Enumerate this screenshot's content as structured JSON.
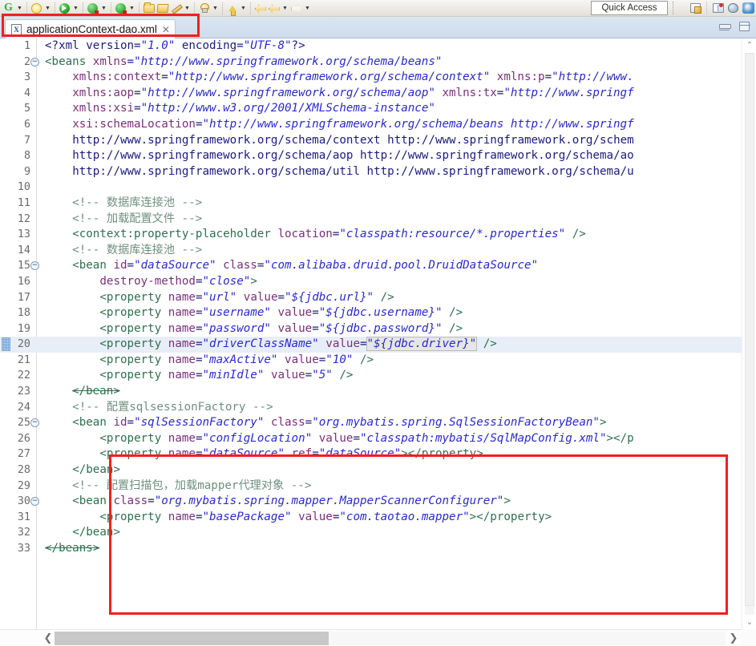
{
  "window": {
    "app": "Eclipse IDE",
    "quick_access_label": "Quick Access"
  },
  "toolbar": {
    "icons": [
      {
        "name": "google-search-icon",
        "label": "G"
      },
      {
        "name": "debug-icon",
        "label": "Debug"
      },
      {
        "name": "run-icon",
        "label": "Run"
      },
      {
        "name": "run-external-tools-icon",
        "label": "External Tools"
      },
      {
        "name": "run-configurations-icon",
        "label": "Run Configurations"
      },
      {
        "name": "new-folder-icon",
        "label": "New"
      },
      {
        "name": "open-folder-icon",
        "label": "Open"
      },
      {
        "name": "build-icon",
        "label": "Build"
      },
      {
        "name": "tip-icon",
        "label": "Hint"
      },
      {
        "name": "up-arrow-icon",
        "label": "Up"
      },
      {
        "name": "back-arrow-icon",
        "label": "Back"
      },
      {
        "name": "forward-arrow-icon",
        "label": "Forward"
      }
    ],
    "right_icons": [
      {
        "name": "open-perspective-icon",
        "label": "Open Perspective"
      },
      {
        "name": "java-perspective-icon",
        "label": "Java EE"
      },
      {
        "name": "debug-perspective-icon",
        "label": "Debug"
      },
      {
        "name": "web-perspective-icon",
        "label": "Web"
      }
    ]
  },
  "editor_tab": {
    "file_icon_letter": "X",
    "filename": "applicationContext-dao.xml",
    "close_glyph": "✕"
  },
  "view_controls": {
    "minimize_title": "Minimize",
    "maximize_title": "Maximize"
  },
  "annotations": [
    {
      "name": "annotation-box-tab",
      "target": "editor tab applicationContext-dao.xml",
      "color": "#ef2020"
    },
    {
      "name": "annotation-box-code",
      "target": "mybatis sqlSessionFactory and MapperScannerConfigurer block (lines 23-33)",
      "color": "#ef2020"
    }
  ],
  "scrollbars": {
    "vertical_up": "⌃",
    "vertical_down": "⌄",
    "horizontal_left": "❮",
    "horizontal_right": "❯"
  },
  "code": {
    "language": "xml",
    "current_line": 20,
    "fold_lines": [
      2,
      15,
      25,
      30
    ],
    "total_lines": 33,
    "lines": [
      {
        "n": 1,
        "text": "<?xml version=\"1.0\" encoding=\"UTF-8\"?>"
      },
      {
        "n": 2,
        "text": "<beans xmlns=\"http://www.springframework.org/schema/beans\""
      },
      {
        "n": 3,
        "text": "    xmlns:context=\"http://www.springframework.org/schema/context\" xmlns:p=\"http://www."
      },
      {
        "n": 4,
        "text": "    xmlns:aop=\"http://www.springframework.org/schema/aop\" xmlns:tx=\"http://www.springf"
      },
      {
        "n": 5,
        "text": "    xmlns:xsi=\"http://www.w3.org/2001/XMLSchema-instance\""
      },
      {
        "n": 6,
        "text": "    xsi:schemaLocation=\"http://www.springframework.org/schema/beans http://www.springf"
      },
      {
        "n": 7,
        "text": "    http://www.springframework.org/schema/context http://www.springframework.org/schem"
      },
      {
        "n": 8,
        "text": "    http://www.springframework.org/schema/aop http://www.springframework.org/schema/ao"
      },
      {
        "n": 9,
        "text": "    http://www.springframework.org/schema/util http://www.springframework.org/schema/u"
      },
      {
        "n": 10,
        "text": ""
      },
      {
        "n": 11,
        "text": "    <!-- 数据库连接池 -->"
      },
      {
        "n": 12,
        "text": "    <!-- 加载配置文件 -->"
      },
      {
        "n": 13,
        "text": "    <context:property-placeholder location=\"classpath:resource/*.properties\" />"
      },
      {
        "n": 14,
        "text": "    <!-- 数据库连接池 -->"
      },
      {
        "n": 15,
        "text": "    <bean id=\"dataSource\" class=\"com.alibaba.druid.pool.DruidDataSource\""
      },
      {
        "n": 16,
        "text": "        destroy-method=\"close\">"
      },
      {
        "n": 17,
        "text": "        <property name=\"url\" value=\"${jdbc.url}\" />"
      },
      {
        "n": 18,
        "text": "        <property name=\"username\" value=\"${jdbc.username}\" />"
      },
      {
        "n": 19,
        "text": "        <property name=\"password\" value=\"${jdbc.password}\" />"
      },
      {
        "n": 20,
        "text": "        <property name=\"driverClassName\" value=\"${jdbc.driver}\" />"
      },
      {
        "n": 21,
        "text": "        <property name=\"maxActive\" value=\"10\" />"
      },
      {
        "n": 22,
        "text": "        <property name=\"minIdle\" value=\"5\" />"
      },
      {
        "n": 23,
        "text": "    </bean>"
      },
      {
        "n": 24,
        "text": "    <!-- 配置sqlsessionFactory -->"
      },
      {
        "n": 25,
        "text": "    <bean id=\"sqlSessionFactory\" class=\"org.mybatis.spring.SqlSessionFactoryBean\">"
      },
      {
        "n": 26,
        "text": "        <property name=\"configLocation\" value=\"classpath:mybatis/SqlMapConfig.xml\"></p"
      },
      {
        "n": 27,
        "text": "        <property name=\"dataSource\" ref=\"dataSource\"></property>"
      },
      {
        "n": 28,
        "text": "    </bean>"
      },
      {
        "n": 29,
        "text": "    <!-- 配置扫描包，加载mapper代理对象 -->"
      },
      {
        "n": 30,
        "text": "    <bean class=\"org.mybatis.spring.mapper.MapperScannerConfigurer\">"
      },
      {
        "n": 31,
        "text": "        <property name=\"basePackage\" value=\"com.taotao.mapper\"></property>"
      },
      {
        "n": 32,
        "text": "    </bean>"
      },
      {
        "n": 33,
        "text": "</beans>"
      }
    ]
  }
}
